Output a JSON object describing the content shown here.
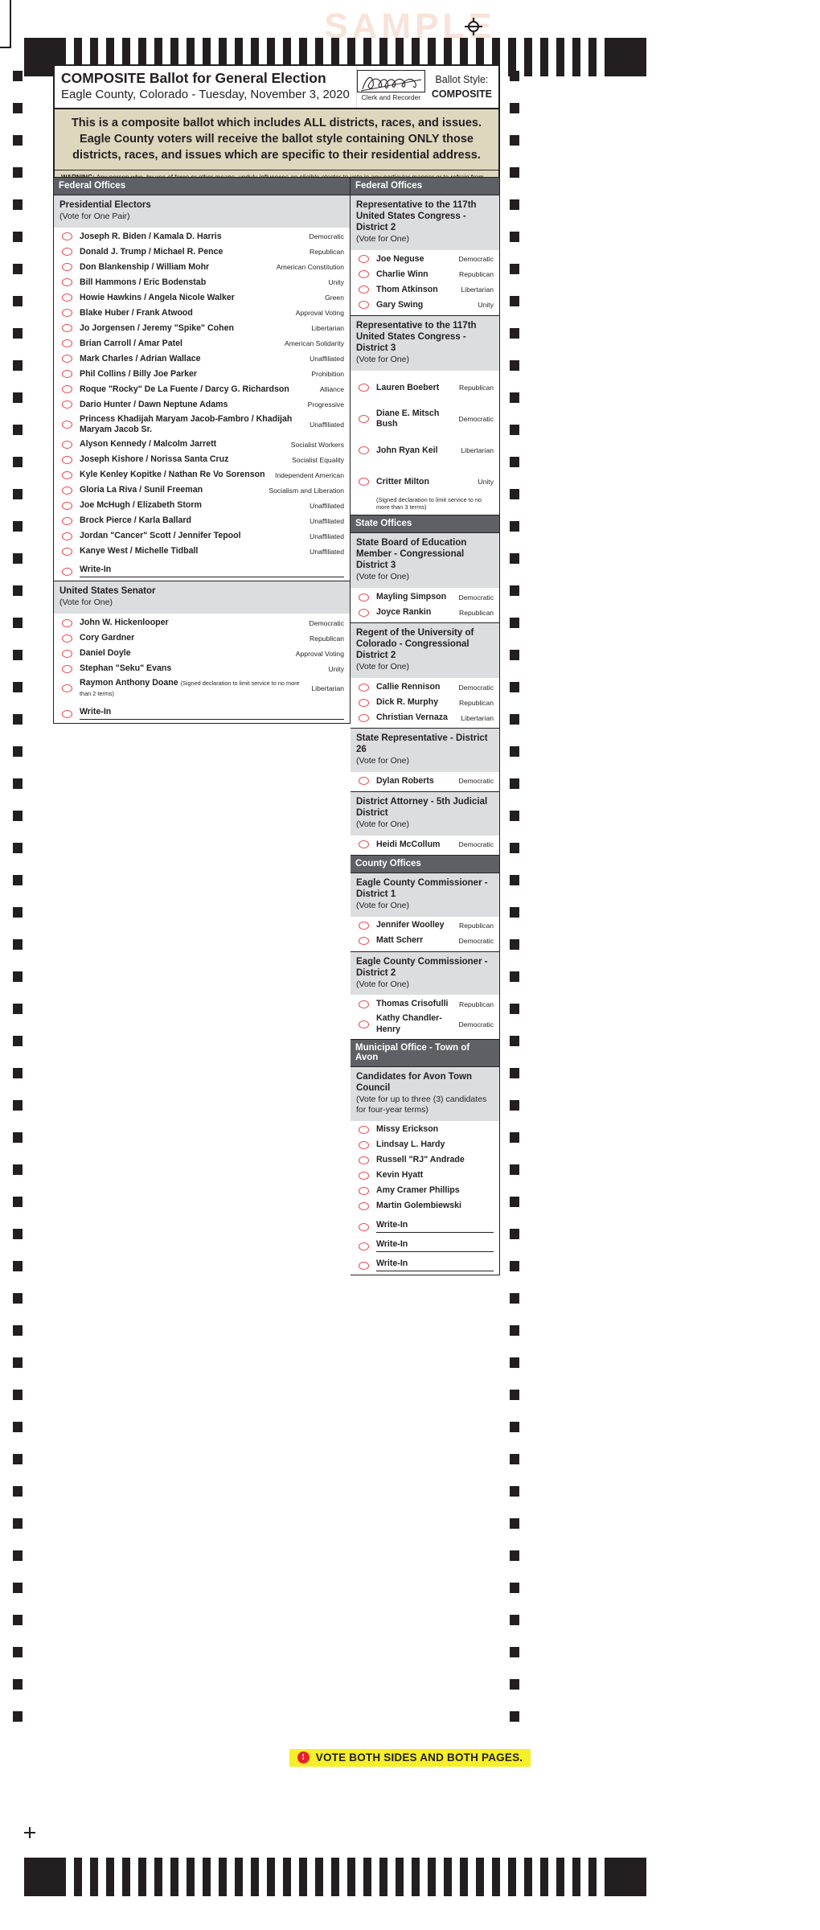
{
  "watermark": "SAMPLE",
  "header": {
    "title": "COMPOSITE Ballot for General Election",
    "subtitle": "Eagle County, Colorado - Tuesday, November 3, 2020",
    "signature_caption": "Clerk and Recorder",
    "ballot_style_label": "Ballot Style:",
    "ballot_style_value": "COMPOSITE",
    "composite_note": "This is a composite ballot which includes ALL districts, races, and issues.  Eagle County voters will receive the ballot style containing ONLY those districts, races, and issues which are specific to their residential address.",
    "warning_label": "WARNING:",
    "warning_text": " Any person who, by use of force or other means, unduly influences an eligible elector to vote in any particular manner or to refrain from voting, or who falsely makes, alters, forges, or counterfeits any mail ballot before or after it has been cast, or who destroys, defaces, mutilates, or tampers with a ballot is subject, upon conviction, to imprisonment, or to a fine, or both. Section 1-7.5-107(3)(b), C.R.S."
  },
  "colors": {
    "section_header_bg": "#5e6065",
    "contest_header_bg": "#dcdddf",
    "note_bg": "#dcd7bd",
    "oval_red": "#ef3f46",
    "footer_highlight": "#f6ef2a"
  },
  "left_column": {
    "section_label": "Federal Offices",
    "contests": [
      {
        "title": "Presidential Electors",
        "instruction": "(Vote for One Pair)",
        "candidates": [
          {
            "name": "Joseph R. Biden / Kamala D. Harris",
            "party": "Democratic"
          },
          {
            "name": "Donald J. Trump / Michael R. Pence",
            "party": "Republican"
          },
          {
            "name": "Don Blankenship / William Mohr",
            "party": "American Constitution"
          },
          {
            "name": "Bill Hammons / Eric Bodenstab",
            "party": "Unity"
          },
          {
            "name": "Howie Hawkins / Angela Nicole Walker",
            "party": "Green"
          },
          {
            "name": "Blake Huber / Frank Atwood",
            "party": "Approval Voting"
          },
          {
            "name": "Jo Jorgensen / Jeremy \"Spike\" Cohen",
            "party": "Libertarian"
          },
          {
            "name": "Brian Carroll / Amar Patel",
            "party": "American Solidarity"
          },
          {
            "name": "Mark Charles / Adrian Wallace",
            "party": "Unaffiliated"
          },
          {
            "name": "Phil Collins / Billy Joe Parker",
            "party": "Prohibition"
          },
          {
            "name": "Roque \"Rocky\" De La Fuente / Darcy G. Richardson",
            "party": "Alliance"
          },
          {
            "name": "Dario Hunter / Dawn Neptune Adams",
            "party": "Progressive"
          },
          {
            "name": "Princess Khadijah Maryam Jacob-Fambro / Khadijah Maryam Jacob Sr.",
            "party": "Unaffiliated"
          },
          {
            "name": "Alyson Kennedy / Malcolm Jarrett",
            "party": "Socialist Workers"
          },
          {
            "name": "Joseph Kishore / Norissa Santa Cruz",
            "party": "Socialist Equality"
          },
          {
            "name": "Kyle Kenley Kopitke / Nathan Re Vo Sorenson",
            "party": "Independent American"
          },
          {
            "name": "Gloria La Riva / Sunil Freeman",
            "party": "Socialism and Liberation"
          },
          {
            "name": "Joe McHugh / Elizabeth Storm",
            "party": "Unaffiliated"
          },
          {
            "name": "Brock Pierce / Karla Ballard",
            "party": "Unaffiliated"
          },
          {
            "name": "Jordan \"Cancer\" Scott / Jennifer Tepool",
            "party": "Unaffiliated"
          },
          {
            "name": "Kanye West / Michelle Tidball",
            "party": "Unaffiliated"
          }
        ],
        "write_ins": [
          "Write-In"
        ]
      },
      {
        "title": "United States Senator",
        "instruction": "(Vote for One)",
        "candidates": [
          {
            "name": "John W. Hickenlooper",
            "party": "Democratic"
          },
          {
            "name": "Cory Gardner",
            "party": "Republican"
          },
          {
            "name": "Daniel Doyle",
            "party": "Approval Voting"
          },
          {
            "name": "Stephan \"Seku\" Evans",
            "party": "Unity"
          },
          {
            "name": "Raymon Anthony Doane",
            "declaration": "(Signed declaration to limit service to no more than 2 terms)",
            "party": "Libertarian"
          }
        ],
        "write_ins": [
          "Write-In"
        ]
      }
    ]
  },
  "right_column": {
    "sections": [
      {
        "section_label": "Federal Offices",
        "contests": [
          {
            "title": "Representative to the 117th United States Congress - District 2",
            "instruction": "(Vote for One)",
            "candidates": [
              {
                "name": "Joe Neguse",
                "party": "Democratic"
              },
              {
                "name": "Charlie Winn",
                "party": "Republican"
              },
              {
                "name": "Thom Atkinson",
                "party": "Libertarian"
              },
              {
                "name": "Gary Swing",
                "party": "Unity"
              }
            ]
          },
          {
            "title": "Representative to the 117th United States Congress - District 3",
            "instruction": "(Vote for One)",
            "tall": true,
            "candidates": [
              {
                "name": "Lauren Boebert",
                "party": "Republican"
              },
              {
                "name": "Diane E. Mitsch Bush",
                "party": "Democratic"
              },
              {
                "name": "John Ryan Keil",
                "party": "Libertarian"
              },
              {
                "name": "Critter Milton",
                "party": "Unity",
                "declaration_block": "(Signed declaration to limit service to no more than 3 terms)"
              }
            ]
          }
        ]
      },
      {
        "section_label": "State Offices",
        "contests": [
          {
            "title": "State Board of Education Member - Congressional District 3",
            "instruction": "(Vote for One)",
            "candidates": [
              {
                "name": "Mayling Simpson",
                "party": "Democratic"
              },
              {
                "name": "Joyce Rankin",
                "party": "Republican"
              }
            ]
          },
          {
            "title": "Regent of the University of Colorado - Congressional District 2",
            "instruction": "(Vote for One)",
            "candidates": [
              {
                "name": "Callie Rennison",
                "party": "Democratic"
              },
              {
                "name": "Dick R. Murphy",
                "party": "Republican"
              },
              {
                "name": "Christian Vernaza",
                "party": "Libertarian"
              }
            ]
          },
          {
            "title": "State Representative - District 26",
            "instruction": "(Vote for One)",
            "candidates": [
              {
                "name": "Dylan Roberts",
                "party": "Democratic"
              }
            ]
          },
          {
            "title": "District Attorney - 5th Judicial District",
            "instruction": "(Vote for One)",
            "candidates": [
              {
                "name": "Heidi McCollum",
                "party": "Democratic"
              }
            ]
          }
        ]
      },
      {
        "section_label": "County Offices",
        "contests": [
          {
            "title": "Eagle County Commissioner - District 1",
            "instruction": "(Vote for One)",
            "candidates": [
              {
                "name": "Jennifer Woolley",
                "party": "Republican"
              },
              {
                "name": "Matt Scherr",
                "party": "Democratic"
              }
            ]
          },
          {
            "title": "Eagle County Commissioner - District 2",
            "instruction": "(Vote for One)",
            "candidates": [
              {
                "name": "Thomas Crisofulli",
                "party": "Republican"
              },
              {
                "name": "Kathy Chandler-Henry",
                "party": "Democratic"
              }
            ]
          }
        ]
      },
      {
        "section_label": "Municipal Office - Town of Avon",
        "contests": [
          {
            "title": "Candidates for Avon Town Council",
            "instruction": "(Vote for up to three (3) candidates for four-year terms)",
            "candidates": [
              {
                "name": "Missy Erickson",
                "party": ""
              },
              {
                "name": "Lindsay L. Hardy",
                "party": ""
              },
              {
                "name": "Russell \"RJ\" Andrade",
                "party": ""
              },
              {
                "name": "Kevin Hyatt",
                "party": ""
              },
              {
                "name": "Amy Cramer Phillips",
                "party": ""
              },
              {
                "name": "Martin Golembiewski",
                "party": ""
              }
            ],
            "write_ins": [
              "Write-In",
              "Write-In",
              "Write-In"
            ]
          }
        ]
      }
    ]
  },
  "footer": {
    "icon": "exclamation-icon",
    "text": "VOTE BOTH SIDES AND BOTH PAGES."
  }
}
